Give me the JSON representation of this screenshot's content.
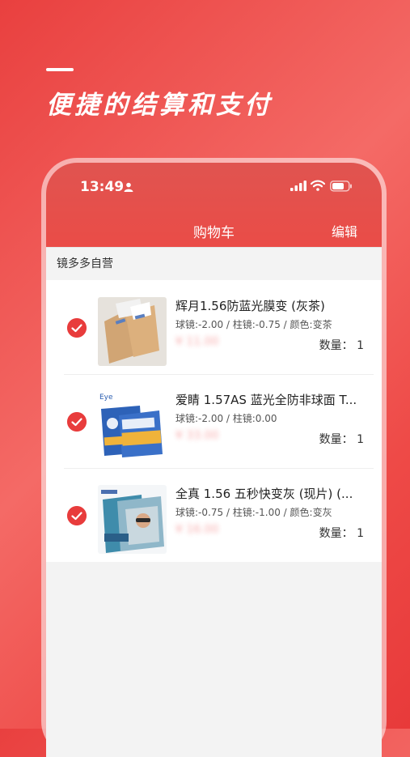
{
  "promo": {
    "title": "便捷的结算和支付"
  },
  "status_bar": {
    "time": "13:49"
  },
  "nav": {
    "title": "购物车",
    "edit_label": "编辑"
  },
  "store": {
    "name": "镜多多自营"
  },
  "items": [
    {
      "name": "辉月1.56防蓝光膜变 (灰茶)",
      "spec": "球镜:-2.00 / 柱镜:-0.75 / 颜色:变茶",
      "price": "¥ 11.00",
      "qty": "数量： 1"
    },
    {
      "name": "爱睛 1.57AS 蓝光全防非球面 T...",
      "spec": "球镜:-2.00 / 柱镜:0.00",
      "price": "¥ 33.00",
      "qty": "数量： 1"
    },
    {
      "name": "全真 1.56 五秒快变灰 (现片) (...",
      "spec": "球镜:-0.75 / 柱镜:-1.00 / 颜色:变灰",
      "price": "¥ 16.00",
      "qty": "数量： 1"
    }
  ],
  "colors": {
    "accent": "#e83c3c",
    "header": "#e54e4a"
  }
}
